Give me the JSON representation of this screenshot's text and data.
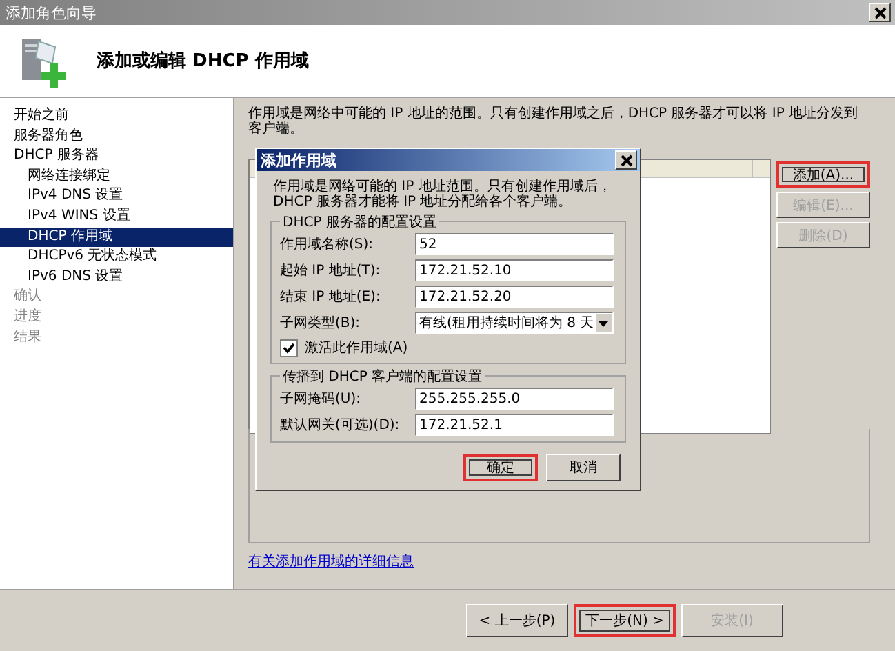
{
  "window": {
    "title": "添加角色向导"
  },
  "header": {
    "title": "添加或编辑 DHCP 作用域"
  },
  "sidebar": {
    "items": [
      {
        "label": "开始之前",
        "selected": false,
        "disabled": false
      },
      {
        "label": "服务器角色",
        "selected": false,
        "disabled": false
      },
      {
        "label": "DHCP 服务器",
        "selected": false,
        "disabled": false,
        "children": [
          {
            "label": "网络连接绑定",
            "selected": false,
            "disabled": false
          },
          {
            "label": "IPv4 DNS 设置",
            "selected": false,
            "disabled": false
          },
          {
            "label": "IPv4 WINS 设置",
            "selected": false,
            "disabled": false
          },
          {
            "label": "DHCP 作用域",
            "selected": true,
            "disabled": false
          },
          {
            "label": "DHCPv6 无状态模式",
            "selected": false,
            "disabled": false
          },
          {
            "label": "IPv6 DNS 设置",
            "selected": false,
            "disabled": false
          }
        ]
      },
      {
        "label": "确认",
        "selected": false,
        "disabled": true
      },
      {
        "label": "进度",
        "selected": false,
        "disabled": true
      },
      {
        "label": "结果",
        "selected": false,
        "disabled": true
      }
    ]
  },
  "main": {
    "description": "作用域是网络中可能的 IP 地址的范围。只有创建作用域之后，DHCP 服务器才可以将 IP 地址分发到客户端。",
    "buttons": [
      {
        "label": "添加(A)...",
        "disabled": false,
        "highlighted": true
      },
      {
        "label": "编辑(E)...",
        "disabled": true,
        "highlighted": false
      },
      {
        "label": "删除(D)",
        "disabled": true,
        "highlighted": false
      }
    ],
    "link": "有关添加作用域的详细信息"
  },
  "dialog": {
    "title": "添加作用域",
    "description": "作用域是网络可能的 IP 地址范围。只有创建作用域后，DHCP 服务器才能将 IP 地址分配给各个客户端。",
    "groups": [
      {
        "title": "DHCP 服务器的配置设置",
        "fields": [
          {
            "kind": "text",
            "label": "作用域名称(S):",
            "value": "52"
          },
          {
            "kind": "text",
            "label": "起始 IP 地址(T):",
            "value": "172.21.52.10"
          },
          {
            "kind": "text",
            "label": "结束 IP 地址(E):",
            "value": "172.21.52.20"
          },
          {
            "kind": "select",
            "label": "子网类型(B):",
            "value": "有线(租用持续时间将为 8 天"
          },
          {
            "kind": "checkbox",
            "label": "激活此作用域(A)",
            "checked": true
          }
        ]
      },
      {
        "title": "传播到 DHCP 客户端的配置设置",
        "fields": [
          {
            "kind": "text",
            "label": "子网掩码(U):",
            "value": "255.255.255.0"
          },
          {
            "kind": "text",
            "label": "默认网关(可选)(D):",
            "value": "172.21.52.1"
          }
        ]
      }
    ],
    "buttons": [
      {
        "label": "确定",
        "highlighted": true
      },
      {
        "label": "取消",
        "highlighted": false
      }
    ]
  },
  "footer": {
    "buttons": [
      {
        "label": "< 上一步(P)",
        "disabled": false,
        "highlighted": false
      },
      {
        "label": "下一步(N) >",
        "disabled": false,
        "highlighted": true
      },
      {
        "label": "安装(I)",
        "disabled": true,
        "highlighted": false
      }
    ]
  }
}
